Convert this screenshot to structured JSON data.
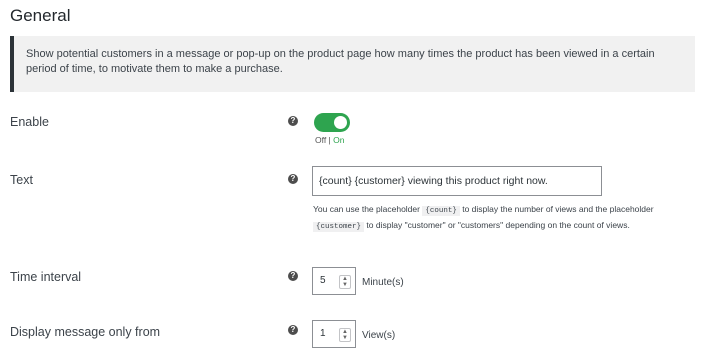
{
  "page": {
    "title": "General"
  },
  "notice": {
    "text": "Show potential customers in a message or pop-up on the product page how many times the product has been viewed in a certain period of time, to motivate them to make a purchase."
  },
  "enable": {
    "label": "Enable",
    "off_label": "Off",
    "separator": " | ",
    "on_label": "On",
    "value": true
  },
  "text_setting": {
    "label": "Text",
    "value": "{count} {customer} viewing this product right now.",
    "desc_part1": "You can use the placeholder ",
    "code1": "{count}",
    "desc_part2": " to display the number of views and the placeholder ",
    "code2": "{customer}",
    "desc_part3": " to display \"customer\" or \"customers\" depending on the count of views."
  },
  "time_interval": {
    "label": "Time interval",
    "value": "5",
    "unit": "Minute(s)"
  },
  "display_from": {
    "label": "Display message only from",
    "value": "1",
    "unit": "View(s)"
  },
  "icons": {
    "help": "question-circle-icon",
    "spinner": "spinner-arrows-icon"
  },
  "colors": {
    "accent_green": "#2ea44f",
    "notice_border": "#2c3338",
    "notice_bg": "#f1f1f1"
  }
}
